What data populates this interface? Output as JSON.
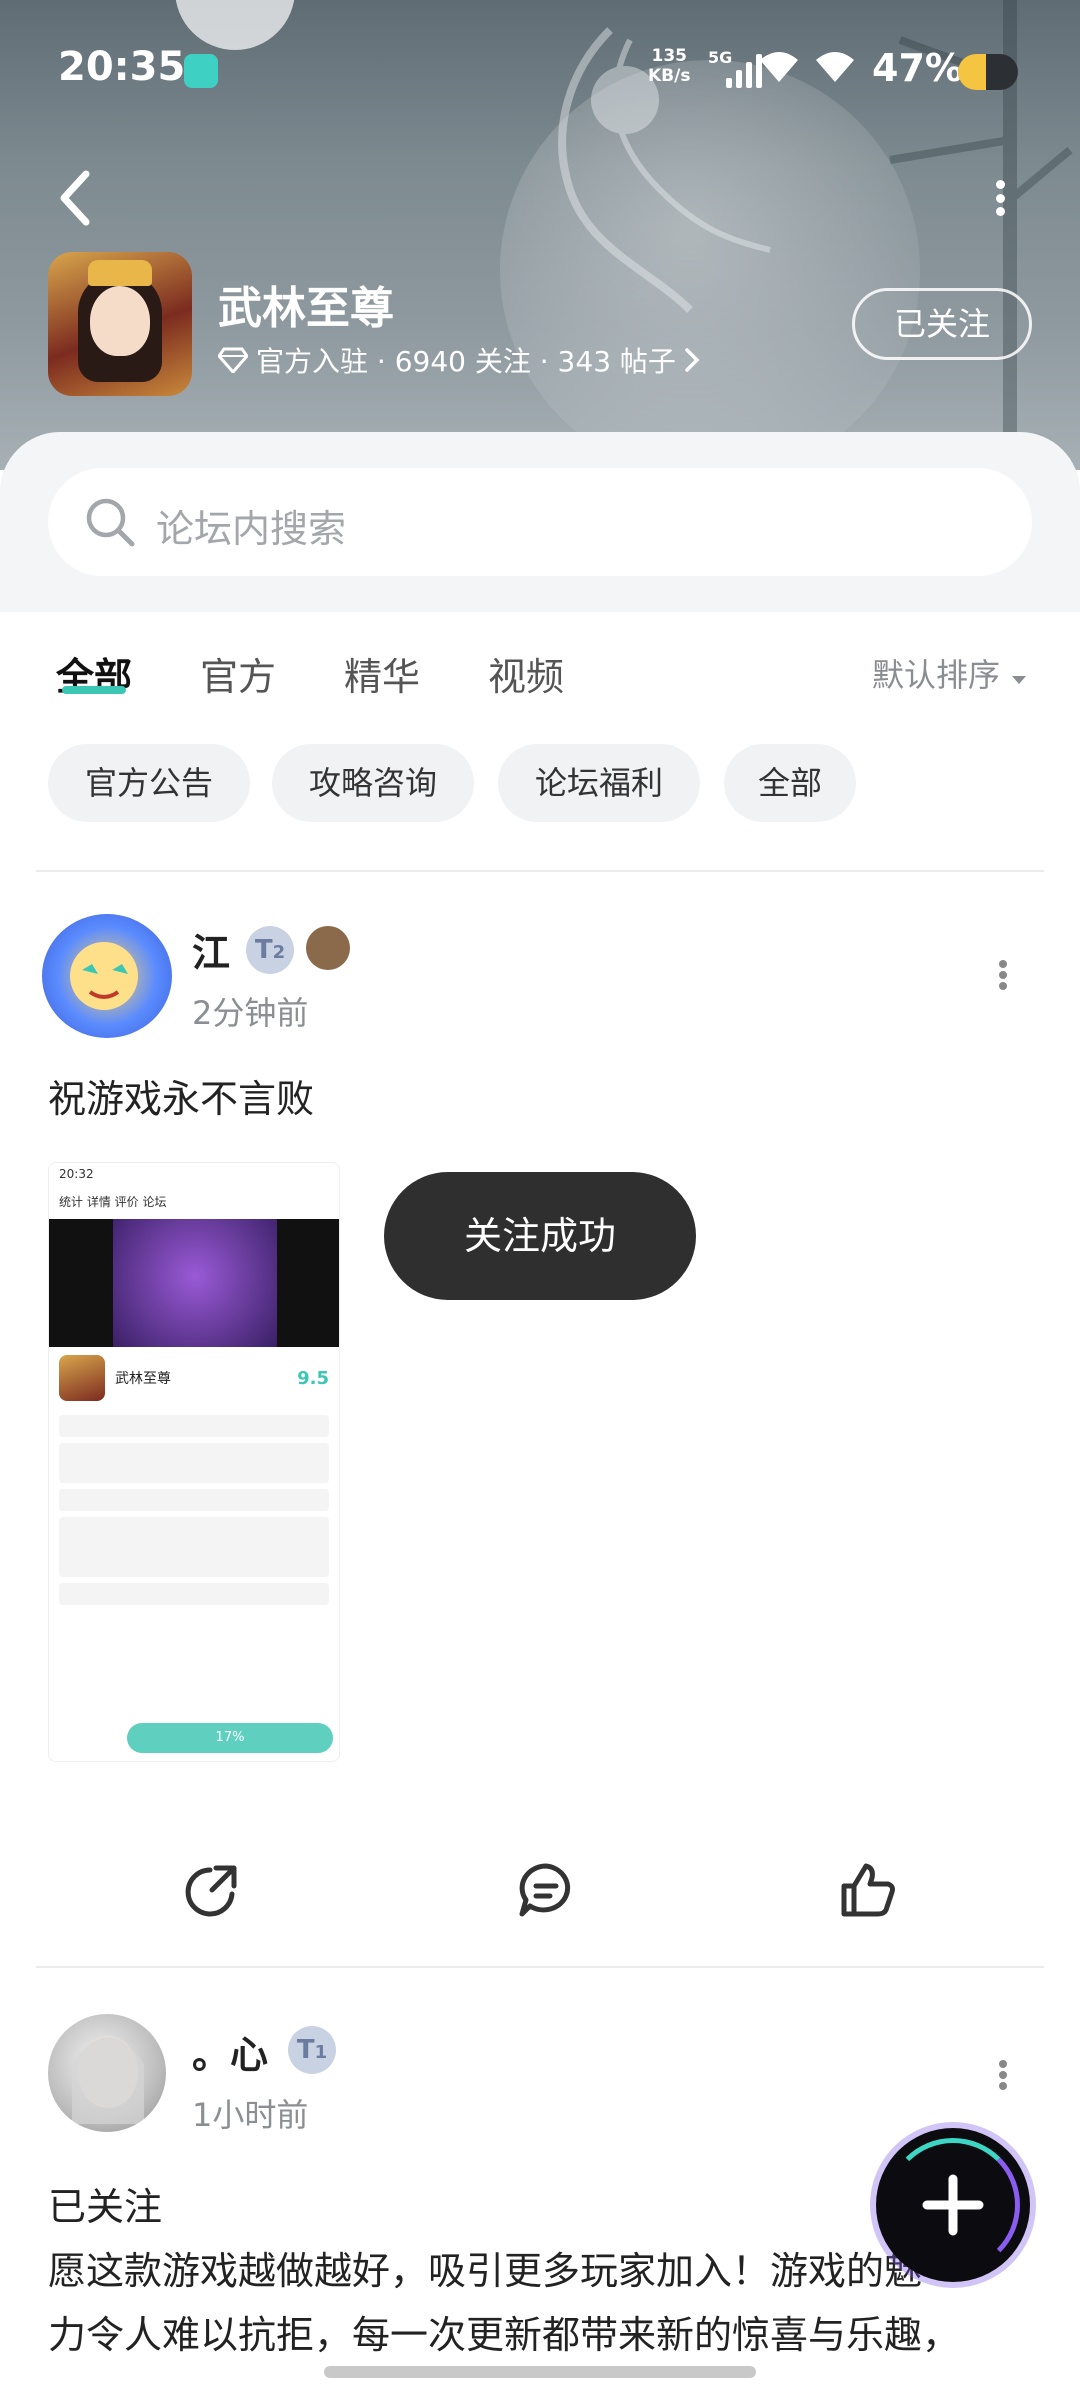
{
  "status_bar": {
    "time": "20:35",
    "net_speed_value": "135",
    "net_speed_unit": "KB/s",
    "network": "5G",
    "battery": "47%"
  },
  "header": {
    "game_name": "武林至尊",
    "meta": "官方入驻 · 6940 关注 · 343 帖子",
    "follow_button": "已关注"
  },
  "search": {
    "placeholder": "论坛内搜索"
  },
  "tabs": [
    {
      "label": "全部",
      "active": true
    },
    {
      "label": "官方",
      "active": false
    },
    {
      "label": "精华",
      "active": false
    },
    {
      "label": "视频",
      "active": false
    }
  ],
  "sort_label": "默认排序",
  "chips": [
    "官方公告",
    "攻略咨询",
    "论坛福利",
    "全部"
  ],
  "posts": [
    {
      "username": "江",
      "level": "2",
      "time": "2分钟前",
      "text": "祝游戏永不言败",
      "screenshot": {
        "status_time": "20:32",
        "nav": "统计   详情   评价   论坛",
        "game_name": "武林至尊",
        "score": "9.5",
        "progress": "17%"
      }
    },
    {
      "username": "。心",
      "level": "1",
      "time": "1小时前",
      "text_line1": "已关注",
      "text_line2": "愿这款游戏越做越好，吸引更多玩家加入！游戏的魅",
      "text_line3": "力令人难以抗拒，每一次更新都带来新的惊喜与乐趣，"
    }
  ],
  "toast": "关注成功",
  "icons": {
    "back": "chevron-left-icon",
    "more": "more-vertical-icon",
    "search": "search-icon",
    "share": "share-icon",
    "comment": "comment-icon",
    "like": "thumbs-up-icon",
    "fab": "plus-icon"
  },
  "colors": {
    "accent": "#3cc6b4",
    "toast_bg": "#2f2f2f"
  }
}
